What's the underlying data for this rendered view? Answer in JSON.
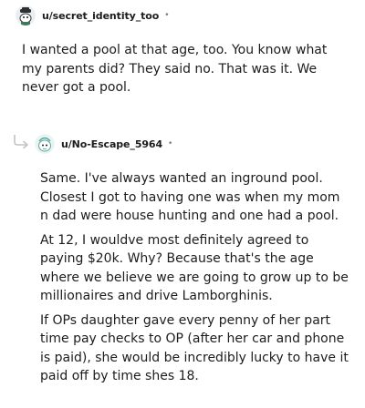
{
  "comments": [
    {
      "username": "u/secret_identity_too",
      "separator": "•",
      "avatar_icon": "snoo-avatar-icon",
      "paragraphs": [
        "I wanted a pool at that age, too. You know what my parents did? They said no. That was it. We never got a pool."
      ]
    },
    {
      "username": "u/No-Escape_5964",
      "separator": "•",
      "avatar_icon": "snoo-avatar-icon",
      "reply_icon": "reply-arrow-icon",
      "paragraphs": [
        "Same. I've always wanted an inground pool. Closest I got to having one was when my mom n dad were house hunting and one had a pool.",
        "At 12, I wouldve most definitely agreed to paying $20k. Why? Because that's the age where we believe we are going to grow up to be millionaires and drive Lamborghinis.",
        "If OPs daughter gave every penny of her part time pay checks to OP (after her car and phone is paid), she would be incredibly lucky to have it paid off by time shes 18."
      ]
    }
  ],
  "colors": {
    "text": "#1c1c1c",
    "meta": "#7c7c7c",
    "reply_line": "#c4c4c4"
  }
}
